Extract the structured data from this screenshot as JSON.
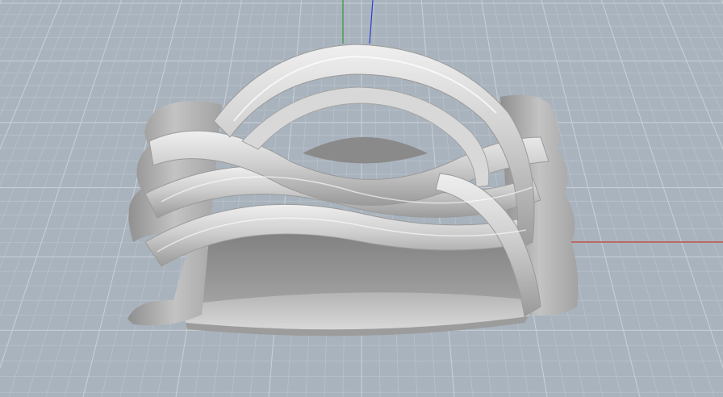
{
  "viewport": {
    "background_color": "#a9b3bd",
    "grid_minor_color": "#b9c1ca",
    "grid_major_color": "#c7ced6",
    "grid_visible": true
  },
  "axes": {
    "x_axis_color": "#c0392b",
    "y_axis_color": "#2e9b3a",
    "z_axis_color": "#2b3fd6"
  },
  "model": {
    "object_icon": "braided-ring-model",
    "surface_color": "#c9c9c9",
    "shadow_color": "#8e8e8e",
    "highlight_color": "#f2f2f2"
  }
}
